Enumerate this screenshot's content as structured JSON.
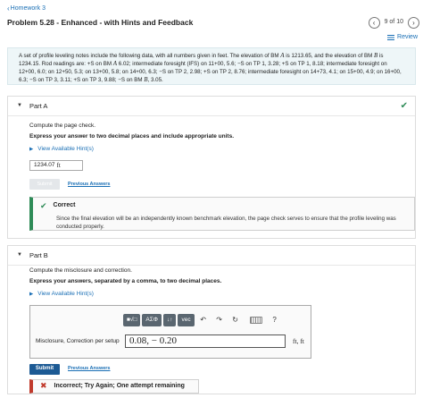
{
  "header": {
    "back_label": "Homework 3",
    "problem_title": "Problem 5.28 - Enhanced - with Hints and Feedback",
    "nav_count": "9 of 10",
    "review_label": "Review"
  },
  "problem": {
    "text_1": "A set of profile leveling notes include the following data, with all numbers given in feet. The elevation of BM ",
    "var_a1": "A",
    "text_2": " is 1213.65, and the elevation of BM ",
    "var_b1": "B",
    "text_3": " is 1234.15. Rod readings are: +S on BM ",
    "var_a2": "A",
    "text_4": " 6.02; intermediate foresight (IFS) on 11+00, 5.6; −S on TP 1, 3.28; +S on TP 1, 8.18; intermediate foresight on 12+00, 6.0; on 12+50, 5.3; on 13+00, 5.8; on 14+00, 6.3; −S on TP 2, 2.98; +S on TP 2, 8.76; intermediate foresight on 14+73, 4.1; on 15+00, 4.9; on 16+00, 6.3; −S on TP 3, 3.11; +S on TP 3, 9.88; −S on BM ",
    "var_b2": "B",
    "text_5": ", 3.05."
  },
  "part_a": {
    "title": "Part A",
    "question": "Compute the page check.",
    "instruction": "Express your answer to two decimal places and include appropriate units.",
    "hints_label": "View Available Hint(s)",
    "answer_value": "1234.07",
    "answer_unit": "ft",
    "submit_label": "Submit",
    "prev_answers_label": "Previous Answers",
    "feedback_title": "Correct",
    "feedback_body": "Since the final elevation will be an independently known benchmark elevation, the page check serves to ensure that the profile leveling was conducted properly."
  },
  "part_b": {
    "title": "Part B",
    "question": "Compute the misclosure and correction.",
    "instruction": "Express your answers, separated by a comma, to two decimal places.",
    "hints_label": "View Available Hint(s)",
    "toolbar": {
      "templates": "■√□",
      "greek": "AΣΦ",
      "arrows": "↓↑",
      "vec": "vec",
      "undo": "↶",
      "redo": "↷",
      "reset": "↻",
      "help": "?"
    },
    "input_label": "Misclosure, Correction per setup",
    "input_value": "0.08, − 0.20",
    "units": "ft, ft",
    "submit_label": "Submit",
    "prev_answers_label": "Previous Answers",
    "feedback_wrong": "Incorrect; Try Again; One attempt remaining"
  },
  "colors": {
    "link": "#1a6fb5",
    "correct": "#2e8b57",
    "incorrect": "#c0392b",
    "submit": "#1c5a94",
    "problem_bg": "#eef6f8"
  },
  "icons": {
    "back": "chevron-left-icon",
    "prev": "chevron-left-icon",
    "next": "chevron-right-icon",
    "review": "list-icon",
    "correct": "check-icon",
    "incorrect": "x-icon"
  }
}
